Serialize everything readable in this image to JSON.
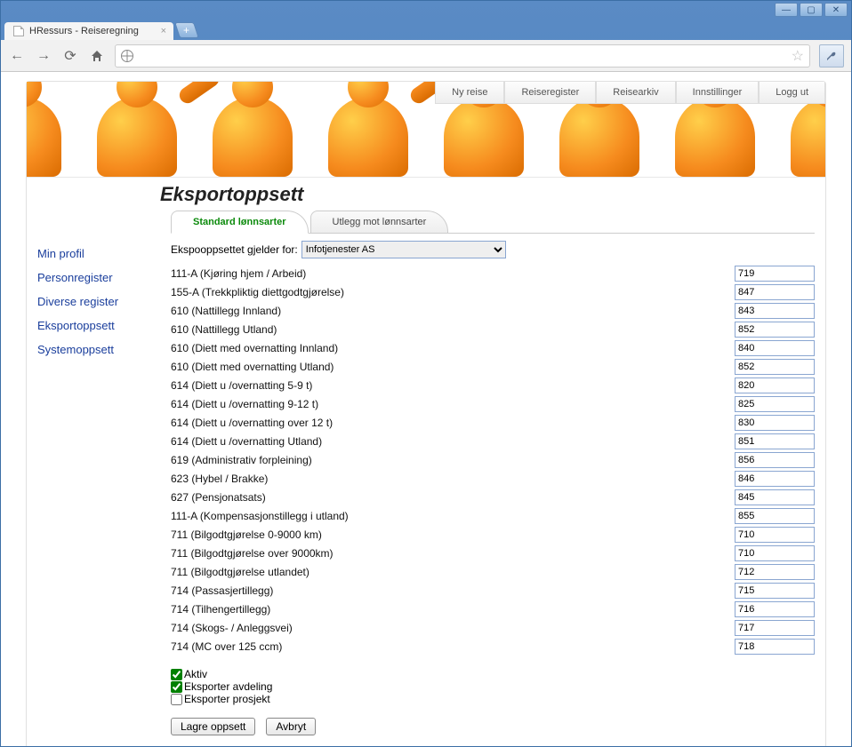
{
  "browser": {
    "tab_title": "HRessurs - Reiseregning"
  },
  "nav": {
    "items": [
      "Ny reise",
      "Reiseregister",
      "Reisearkiv",
      "Innstillinger",
      "Logg ut"
    ]
  },
  "sidebar": {
    "items": [
      "Min profil",
      "Personregister",
      "Diverse register",
      "Eksportoppsett",
      "Systemoppsett"
    ]
  },
  "page": {
    "heading": "Eksportoppsett"
  },
  "tabs": {
    "active": "Standard lønnsarter",
    "other": "Utlegg mot lønnsarter"
  },
  "filter": {
    "label": "Ekspooppsettet gjelder for:",
    "value": "Infotjenester AS"
  },
  "rows": [
    {
      "label": "111-A (Kjøring hjem / Arbeid)",
      "value": "719"
    },
    {
      "label": "155-A (Trekkpliktig diettgodtgjørelse)",
      "value": "847"
    },
    {
      "label": "610 (Nattillegg Innland)",
      "value": "843"
    },
    {
      "label": "610 (Nattillegg Utland)",
      "value": "852"
    },
    {
      "label": "610 (Diett med overnatting Innland)",
      "value": "840"
    },
    {
      "label": "610 (Diett med overnatting Utland)",
      "value": "852"
    },
    {
      "label": "614 (Diett u /overnatting 5-9 t)",
      "value": "820"
    },
    {
      "label": "614 (Diett u /overnatting 9-12 t)",
      "value": "825"
    },
    {
      "label": "614 (Diett u /overnatting over 12 t)",
      "value": "830"
    },
    {
      "label": "614 (Diett u /overnatting Utland)",
      "value": "851"
    },
    {
      "label": "619 (Administrativ forpleining)",
      "value": "856"
    },
    {
      "label": "623 (Hybel / Brakke)",
      "value": "846"
    },
    {
      "label": "627 (Pensjonatsats)",
      "value": "845"
    },
    {
      "label": "111-A (Kompensasjonstillegg i utland)",
      "value": "855"
    },
    {
      "label": "711 (Bilgodtgjørelse 0-9000 km)",
      "value": "710"
    },
    {
      "label": "711 (Bilgodtgjørelse over 9000km)",
      "value": "710"
    },
    {
      "label": "711 (Bilgodtgjørelse utlandet)",
      "value": "712"
    },
    {
      "label": "714 (Passasjertillegg)",
      "value": "715"
    },
    {
      "label": "714 (Tilhengertillegg)",
      "value": "716"
    },
    {
      "label": "714 (Skogs- / Anleggsvei)",
      "value": "717"
    },
    {
      "label": "714 (MC over 125 ccm)",
      "value": "718"
    }
  ],
  "checks": {
    "aktiv": "Aktiv",
    "eksporter_avdeling": "Eksporter avdeling",
    "eksporter_prosjekt": "Eksporter prosjekt"
  },
  "buttons": {
    "save": "Lagre oppsett",
    "cancel": "Avbryt"
  }
}
